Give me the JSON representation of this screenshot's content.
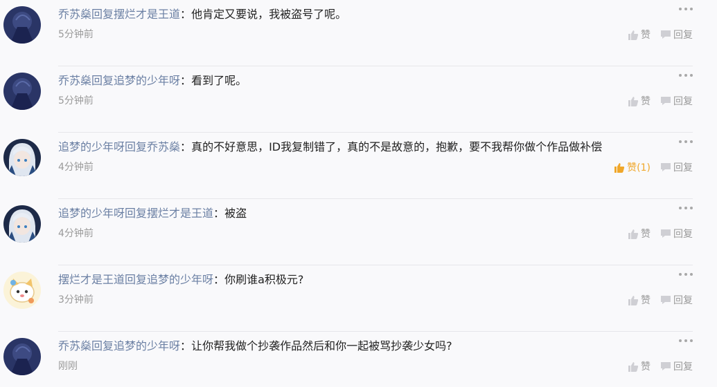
{
  "comments": [
    {
      "user": "乔苏燊",
      "reply_word": "回复",
      "target": "摆烂才是王道",
      "sep": "：",
      "text": "他肯定又要说，我被盗号了呢。",
      "time": "5分钟前",
      "like_label": "赞",
      "reply_label": "回复",
      "avatar": "dark-avatar"
    },
    {
      "user": "乔苏燊",
      "reply_word": "回复",
      "target": "追梦的少年呀",
      "sep": "：",
      "text": "看到了呢。",
      "time": "5分钟前",
      "like_label": "赞",
      "reply_label": "回复",
      "avatar": "dark-avatar"
    },
    {
      "user": "追梦的少年呀",
      "reply_word": "回复",
      "target": "乔苏燊",
      "sep": "：",
      "text": "真的不好意思，ID我复制错了，真的不是故意的，抱歉，要不我帮你做个作品做补偿",
      "time": "4分钟前",
      "like_label": "赞(1)",
      "reply_label": "回复",
      "avatar": "anime-avatar"
    },
    {
      "user": "追梦的少年呀",
      "reply_word": "回复",
      "target": "摆烂才是王道",
      "sep": "：",
      "text": "被盗",
      "time": "4分钟前",
      "like_label": "赞",
      "reply_label": "回复",
      "avatar": "anime-avatar"
    },
    {
      "user": "摆烂才是王道",
      "reply_word": "回复",
      "target": "追梦的少年呀",
      "sep": "：",
      "text": "你刷谁a积极元?",
      "time": "3分钟前",
      "like_label": "赞",
      "reply_label": "回复",
      "avatar": "cat-avatar"
    },
    {
      "user": "乔苏燊",
      "reply_word": "回复",
      "target": "追梦的少年呀",
      "sep": "：",
      "text": "让你帮我做个抄袭作品然后和你一起被骂抄袭少女吗?",
      "time": "刚刚",
      "like_label": "赞",
      "reply_label": "回复",
      "avatar": "dark-avatar"
    }
  ],
  "colors": {
    "username": "#6a7fa3",
    "meta": "#9a9a9a",
    "liked": "#f0a72a",
    "background": "#f9f9fb"
  }
}
